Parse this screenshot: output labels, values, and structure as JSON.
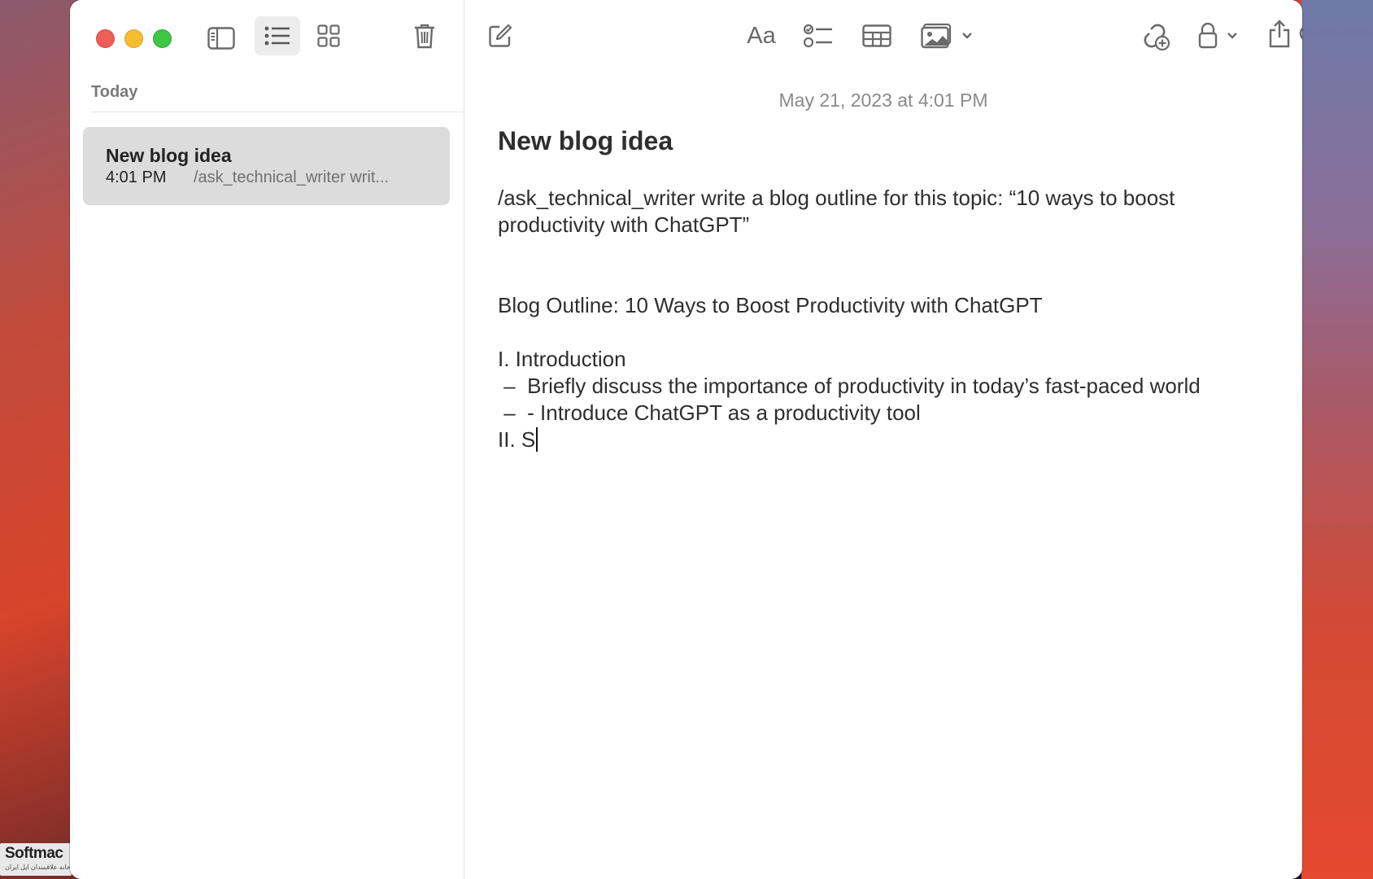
{
  "watermark": {
    "brand": "Softmac",
    "subtitle": "خانه علاقمندان اپل ایران"
  },
  "toolbar": {
    "left_icons": [
      "sidebar-toggle-icon",
      "list-view-icon",
      "gallery-view-icon",
      "trash-icon"
    ],
    "right_icons": [
      "compose-icon",
      "text-format-icon",
      "checklist-icon",
      "table-icon",
      "media-icon",
      "collaborate-icon",
      "lock-icon",
      "share-icon",
      "search-icon"
    ],
    "format_label": "Aa"
  },
  "sidebar": {
    "section_header": "Today",
    "notes": [
      {
        "title": "New blog idea",
        "time": "4:01 PM",
        "snippet": "/ask_technical_writer writ..."
      }
    ]
  },
  "editor": {
    "date": "May 21, 2023 at 4:01 PM",
    "title": "New blog idea",
    "lines": [
      "/ask_technical_writer write a blog outline for this topic: “10 ways to boost",
      "productivity with ChatGPT”",
      "Blog Outline: 10 Ways to Boost Productivity with ChatGPT",
      "I. Introduction",
      " –  Briefly discuss the importance of productivity in today’s fast-paced world",
      " –  - Introduce ChatGPT as a productivity tool",
      "II. S"
    ]
  },
  "colors": {
    "close": "#ee5f57",
    "minimize": "#f6bd31",
    "maximize": "#3ec645",
    "selected_note": "#dcdcdc",
    "icon_gray": "#6a6a6a"
  }
}
